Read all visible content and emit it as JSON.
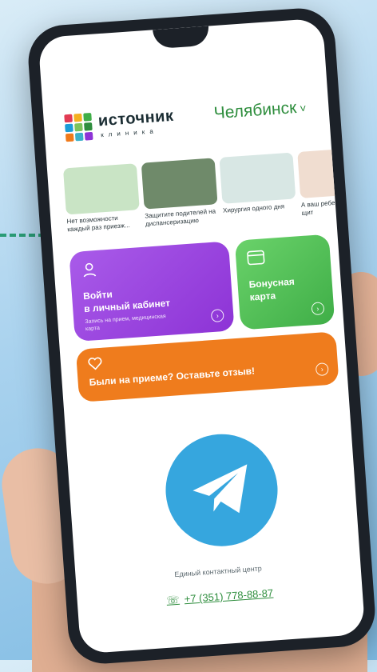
{
  "brand": {
    "name": "источник",
    "sub": "клиника",
    "logo_colors": [
      "#e23b54",
      "#f4b020",
      "#3fae47",
      "#1b9cd8",
      "#7cc35a",
      "#2f8e3e",
      "#f07a1b",
      "#3bb0c9",
      "#8d33d6"
    ]
  },
  "city": {
    "name": "Челябинск",
    "chevron": "chevron-down-icon"
  },
  "stories": [
    {
      "caption": "Нет возможности каждый раз приезж...",
      "color": "#c9e4c5"
    },
    {
      "caption": "Защитите подителей на диспансеризацию",
      "color": "#6f8a6a"
    },
    {
      "caption": "Хирургия одного дня",
      "color": "#d8e7e4"
    },
    {
      "caption": "А ваш ребенок здоров щит",
      "color": "#f0ddd0"
    }
  ],
  "cards": {
    "cabinet": {
      "title": "Войти\nв личный кабинет",
      "subtitle": "Запись на прием, медицинская карта",
      "icon": "user-icon"
    },
    "bonus": {
      "title": "Бонусная\nкарта",
      "icon": "card-icon"
    },
    "review": {
      "title": "Были на приеме? Оставьте отзыв!",
      "icon": "heart-icon"
    }
  },
  "contact": {
    "label": "Единый контактный центр",
    "phone": "+7 (351) 778-88-87",
    "telegram_icon": "telegram-icon"
  },
  "colors": {
    "accent_green": "#2f8e3e",
    "purple": "#8d33d6",
    "green_card": "#3fae47",
    "orange": "#ef7c1d",
    "telegram_blue": "#36a6de"
  }
}
